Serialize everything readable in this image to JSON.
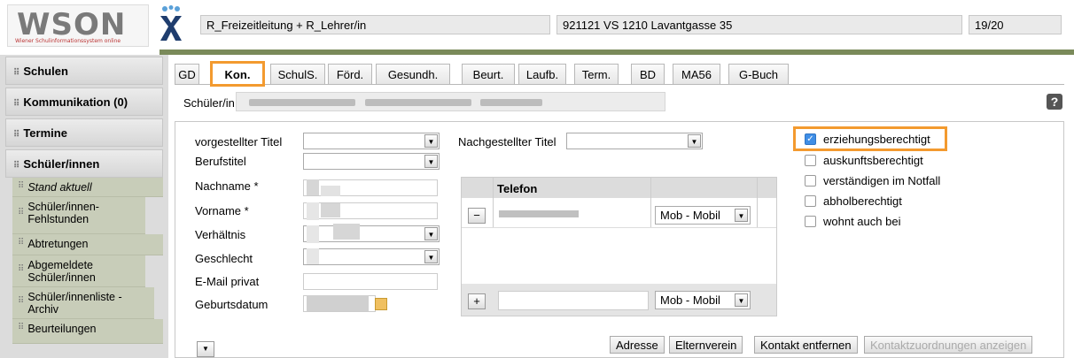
{
  "header": {
    "logo_text": "WSON",
    "logo_badge": "10",
    "logo_subtitle": "Wiener Schulinformationssystem online",
    "role": "R_Freizeitleitung + R_Lehrer/in",
    "school": "921121 VS 1210 Lavantgasse 35",
    "school_year": "19/20"
  },
  "sidebar": {
    "sections": [
      {
        "label": "Schulen"
      },
      {
        "label": "Kommunikation (0)"
      },
      {
        "label": "Termine"
      },
      {
        "label": "Schüler/innen"
      }
    ],
    "items": [
      {
        "label": "Stand aktuell"
      },
      {
        "label": "Schüler/innen-Fehlstunden"
      },
      {
        "label": "Abtretungen"
      },
      {
        "label": "Abgemeldete Schüler/innen"
      },
      {
        "label": "Schüler/innenliste - Archiv"
      },
      {
        "label": "Beurteilungen"
      }
    ]
  },
  "tabs": [
    {
      "label": "GD"
    },
    {
      "label": "Kon."
    },
    {
      "label": "SchulS."
    },
    {
      "label": "Förd."
    },
    {
      "label": "Gesundh."
    },
    {
      "label": "Beurt."
    },
    {
      "label": "Laufb."
    },
    {
      "label": "Term."
    },
    {
      "label": "BD"
    },
    {
      "label": "MA56"
    },
    {
      "label": "G-Buch"
    }
  ],
  "active_tab": "Kon.",
  "student": {
    "label": "Schüler/in"
  },
  "help_label": "?",
  "form": {
    "vorgestellter_titel": "vorgestellter Titel",
    "berufstitel": "Berufstitel",
    "nachname": "Nachname *",
    "vorname": "Vorname *",
    "verhaeltnis": "Verhältnis",
    "geschlecht": "Geschlecht",
    "email": "E-Mail privat",
    "geburtsdatum": "Geburtsdatum",
    "nachgestellter_titel": "Nachgestellter Titel"
  },
  "phone": {
    "header": "Telefon",
    "remove_label": "−",
    "add_label": "+",
    "type_existing": "Mob - Mobil",
    "type_new": "Mob - Mobil"
  },
  "checkboxes": [
    {
      "label": "erziehungsberechtigt",
      "checked": true
    },
    {
      "label": "auskunftsberechtigt",
      "checked": false
    },
    {
      "label": "verständigen im Notfall",
      "checked": false
    },
    {
      "label": "abholberechtigt",
      "checked": false
    },
    {
      "label": "wohnt auch bei",
      "checked": false
    }
  ],
  "buttons": {
    "adresse": "Adresse",
    "elternverein": "Elternverein",
    "kontakt_entfernen": "Kontakt entfernen",
    "kontaktzuordnungen": "Kontaktzuordnungen anzeigen"
  },
  "colors": {
    "highlight": "#f39a2f",
    "accent_green": "#7a8a5a",
    "checkbox_blue": "#3f8ee6"
  }
}
